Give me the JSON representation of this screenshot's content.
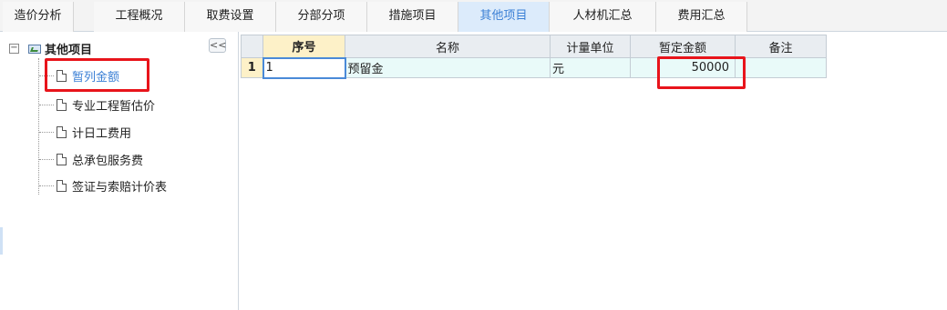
{
  "tabs": [
    {
      "label": "造价分析",
      "active": false
    },
    {
      "label": "工程概况",
      "active": false
    },
    {
      "label": "取费设置",
      "active": false
    },
    {
      "label": "分部分项",
      "active": false
    },
    {
      "label": "措施项目",
      "active": false
    },
    {
      "label": "其他项目",
      "active": true
    },
    {
      "label": "人材机汇总",
      "active": false
    },
    {
      "label": "费用汇总",
      "active": false
    }
  ],
  "tree": {
    "collapse_glyph": "<<",
    "expand_glyph": "−",
    "root_label": "其他项目",
    "items": [
      {
        "label": "暂列金额",
        "selected": true
      },
      {
        "label": "专业工程暂估价",
        "selected": false
      },
      {
        "label": "计日工费用",
        "selected": false
      },
      {
        "label": "总承包服务费",
        "selected": false
      },
      {
        "label": "签证与索赔计价表",
        "selected": false
      }
    ]
  },
  "grid": {
    "headers": [
      "序号",
      "名称",
      "计量单位",
      "暂定金额",
      "备注"
    ],
    "rows": [
      {
        "row_number": "1",
        "seq": "1",
        "name": "预留金",
        "unit": "元",
        "amount": "50000",
        "note": ""
      }
    ]
  },
  "colors": {
    "accent": "#3a7fd5",
    "highlight_box": "#e8141b",
    "row_background": "#e9faf9",
    "active_header": "#fdf1c8"
  }
}
